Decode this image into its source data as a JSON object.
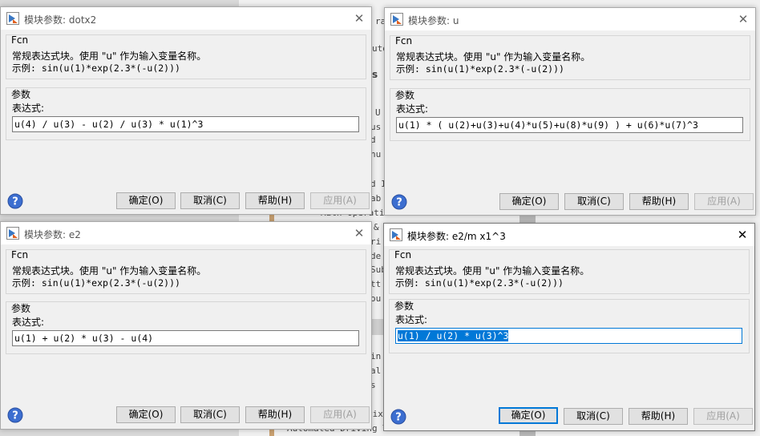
{
  "background": {
    "lines": [
      "ra",
      "uto",
      "s",
      "U",
      "us",
      "d",
      "nu",
      "d I",
      "ab",
      "Math Operations",
      "&",
      "ri",
      "de",
      "Sub",
      "tt",
      "ou",
      "in",
      "al",
      "s",
      "rix",
      "Automated Driving Toolbox"
    ]
  },
  "dialogs": [
    {
      "title": "模块参数: dotx2",
      "block_type": "Fcn",
      "description": "常规表达式块。使用 \"u\" 作为输入变量名称。",
      "example": "示例: sin(u(1)*exp(2.3*(-u(2)))",
      "params_label": "参数",
      "expr_label": "表达式:",
      "expr_value": "u(4) / u(3) - u(2) / u(3) * u(1)^3",
      "buttons": {
        "ok": "确定(O)",
        "cancel": "取消(C)",
        "help": "帮助(H)",
        "apply": "应用(A)"
      }
    },
    {
      "title": "模块参数: u",
      "block_type": "Fcn",
      "description": "常规表达式块。使用 \"u\" 作为输入变量名称。",
      "example": "示例: sin(u(1)*exp(2.3*(-u(2)))",
      "params_label": "参数",
      "expr_label": "表达式:",
      "expr_value": "u(1) * ( u(2)+u(3)+u(4)*u(5)+u(8)*u(9) ) + u(6)*u(7)^3",
      "buttons": {
        "ok": "确定(O)",
        "cancel": "取消(C)",
        "help": "帮助(H)",
        "apply": "应用(A)"
      }
    },
    {
      "title": "模块参数: e2",
      "block_type": "Fcn",
      "description": "常规表达式块。使用 \"u\" 作为输入变量名称。",
      "example": "示例: sin(u(1)*exp(2.3*(-u(2)))",
      "params_label": "参数",
      "expr_label": "表达式:",
      "expr_value": "u(1) + u(2) * u(3) - u(4)",
      "buttons": {
        "ok": "确定(O)",
        "cancel": "取消(C)",
        "help": "帮助(H)",
        "apply": "应用(A)"
      }
    },
    {
      "title": "模块参数: e2/m x1^3",
      "block_type": "Fcn",
      "description": "常规表达式块。使用 \"u\" 作为输入变量名称。",
      "example": "示例: sin(u(1)*exp(2.3*(-u(2)))",
      "params_label": "参数",
      "expr_label": "表达式:",
      "expr_value": "u(1) / u(2) * u(3)^3",
      "buttons": {
        "ok": "确定(O)",
        "cancel": "取消(C)",
        "help": "帮助(H)",
        "apply": "应用(A)"
      }
    }
  ]
}
